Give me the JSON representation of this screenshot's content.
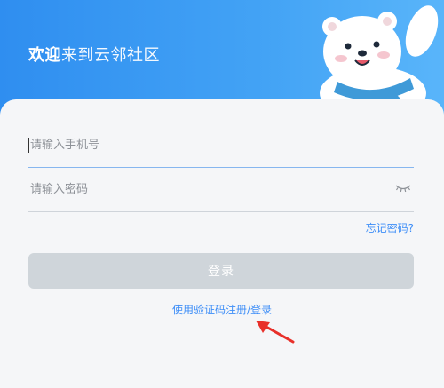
{
  "header": {
    "welcome_bold": "欢迎",
    "welcome_rest": "来到云邻社区",
    "mascot_icon": "polar-bear-mascot"
  },
  "form": {
    "phone_placeholder": "请输入手机号",
    "phone_value": "",
    "password_placeholder": "请输入密码",
    "password_value": "",
    "password_toggle_icon": "eye-closed-icon"
  },
  "links": {
    "forgot_password": "忘记密码?",
    "sms_login": "使用验证码注册/登录"
  },
  "buttons": {
    "login_label": "登录"
  },
  "colors": {
    "header_start": "#2f8ef0",
    "header_end": "#59b5fa",
    "link": "#3e8ef7",
    "button_disabled": "#cfd5da",
    "annotation_arrow": "#e8302a"
  }
}
